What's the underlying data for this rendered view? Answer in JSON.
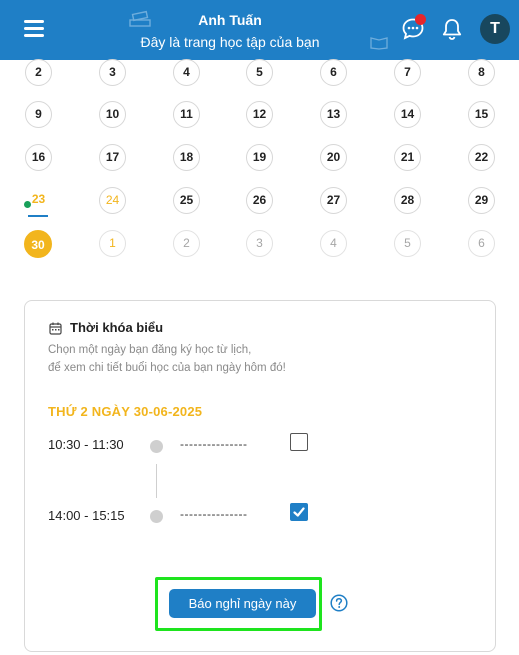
{
  "header": {
    "title": "Anh Tuấn",
    "subtitle": "Đây là trang học tập của bạn",
    "avatar_letter": "T"
  },
  "calendar": {
    "weeks": [
      [
        "2",
        "3",
        "4",
        "5",
        "6",
        "7",
        "8"
      ],
      [
        "9",
        "10",
        "11",
        "12",
        "13",
        "14",
        "15"
      ],
      [
        "16",
        "17",
        "18",
        "19",
        "20",
        "21",
        "22"
      ],
      [
        "23",
        "24",
        "25",
        "26",
        "27",
        "28",
        "29"
      ],
      [
        "30",
        "1",
        "2",
        "3",
        "4",
        "5",
        "6"
      ]
    ],
    "today": "23",
    "selected": "30"
  },
  "schedule": {
    "title": "Thời khóa biểu",
    "hint_line1": "Chọn một ngày bạn đăng ký học từ lịch,",
    "hint_line2": "để xem chi tiết buổi học của bạn ngày hôm đó!",
    "date_heading": "THỨ 2 NGÀY 30-06-2025",
    "slots": [
      {
        "time": "10:30 - 11:30",
        "detail": "---------------",
        "checked": false
      },
      {
        "time": "14:00 - 15:15",
        "detail": "---------------",
        "checked": true
      }
    ],
    "absent_button": "Báo nghỉ ngày này"
  },
  "colors": {
    "header": "#1f7fc6",
    "accent_yellow": "#f2b51d",
    "highlight_green": "#1ee41e",
    "notification_red": "#e5262b"
  }
}
